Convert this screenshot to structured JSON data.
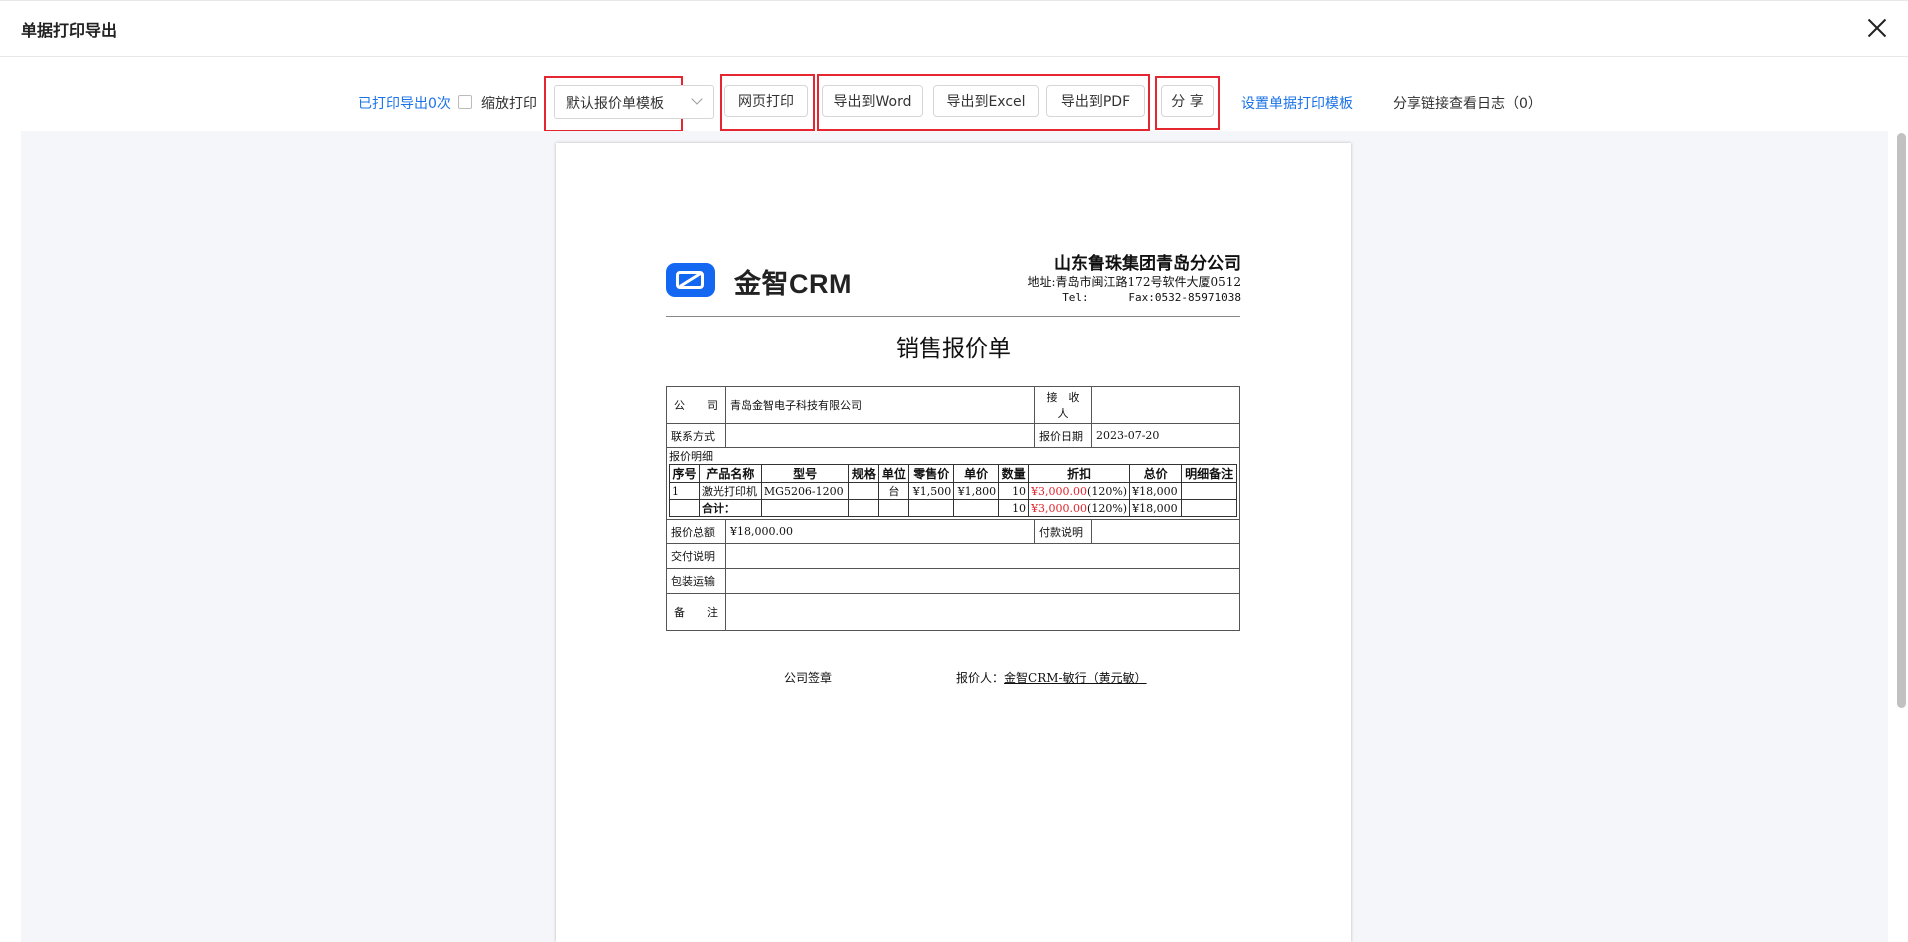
{
  "header": {
    "title": "单据打印导出"
  },
  "toolbar": {
    "print_count": "已打印导出0次",
    "zoom_print": "缩放打印",
    "template_select": "默认报价单模板",
    "web_print": "网页打印",
    "export_word": "导出到Word",
    "export_excel": "导出到Excel",
    "export_pdf": "导出到PDF",
    "share": "分 享",
    "set_template": "设置单据打印模板",
    "share_log": "分享链接查看日志（0）"
  },
  "doc": {
    "logo_text": "金智CRM",
    "company_name": "山东鲁珠集团青岛分公司",
    "address": "地址:青岛市闽江路172号软件大厦0512",
    "tel": "Tel:      Fax:0532-85971038",
    "title": "销售报价单",
    "labels": {
      "company": "公　　司",
      "receiver": "接　收　人",
      "contact": "联系方式",
      "quote_date": "报价日期",
      "detail": "报价明细",
      "total_amount": "报价总额",
      "payment": "付款说明",
      "delivery": "交付说明",
      "packing": "包装运输",
      "remark": "备　　注"
    },
    "values": {
      "company": "青岛金智电子科技有限公司",
      "receiver": "",
      "contact": "",
      "quote_date": "2023-07-20",
      "total_amount": "¥18,000.00",
      "payment": ""
    },
    "item_headers": [
      "序号",
      "产品名称",
      "型号",
      "规格",
      "单位",
      "零售价",
      "单价",
      "数量",
      "折扣",
      "总价",
      "明细备注"
    ],
    "item_row": {
      "no": "1",
      "name": "激光打印机",
      "model": "MG5206-1200",
      "spec": "",
      "unit": "台",
      "retail": "¥1,500",
      "price": "¥1,800",
      "qty": "10",
      "discount_amount": "¥3,000.00",
      "discount_pct": "(120%)",
      "total": "¥18,000",
      "note": ""
    },
    "sum_row": {
      "label": "合计：",
      "qty": "10",
      "discount_amount": "¥3,000.00",
      "discount_pct": "(120%)",
      "total": "¥18,000"
    },
    "sign_company": "公司签章",
    "sign_quoter_label": "报价人：",
    "sign_quoter": "金智CRM-敏行（黄元敏）"
  },
  "colors": {
    "accent": "#1a73e8",
    "highlight": "#e3262f",
    "logo": "#1467f0"
  }
}
